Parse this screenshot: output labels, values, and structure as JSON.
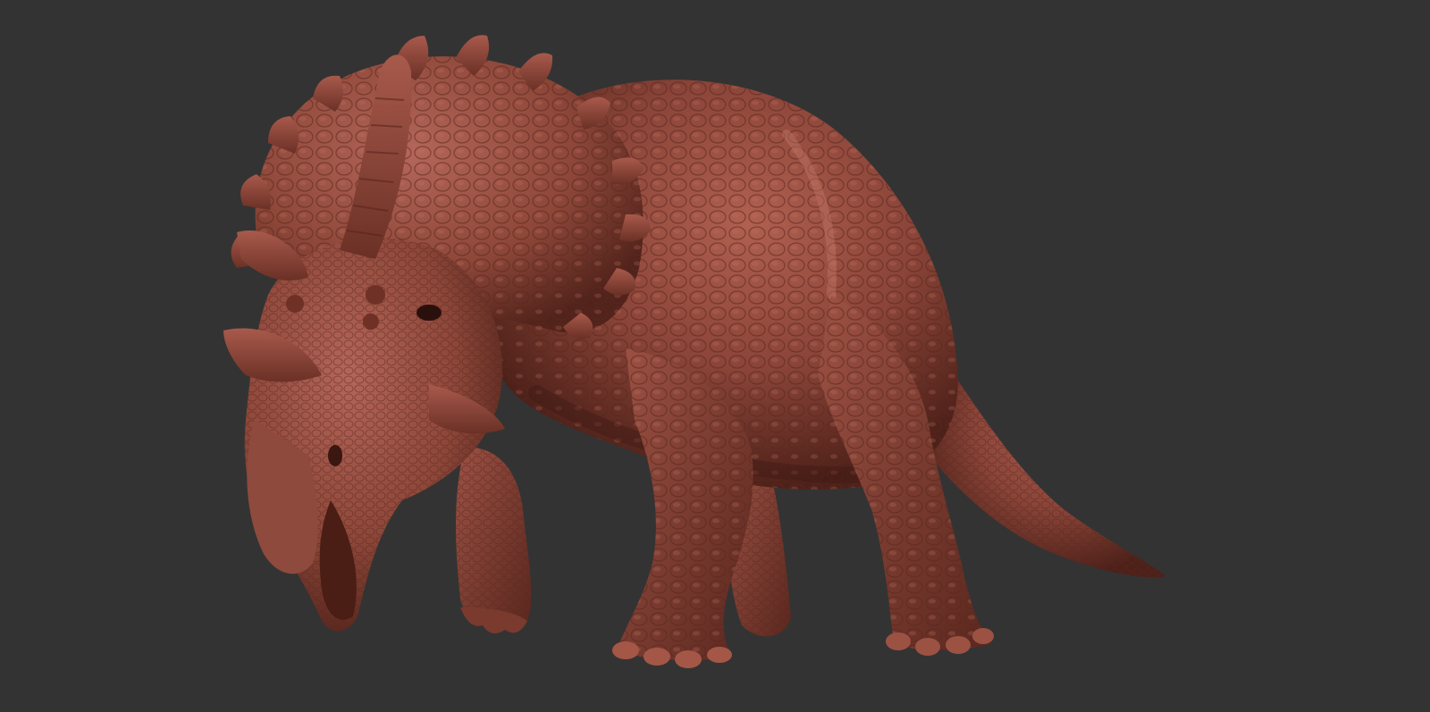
{
  "scene": {
    "background_color": "#333333",
    "subject": "ceratopsian-dinosaur-sculpt",
    "material_color": "#8a4438",
    "material_highlight": "#a9594a",
    "material_shadow": "#4a1f18"
  }
}
